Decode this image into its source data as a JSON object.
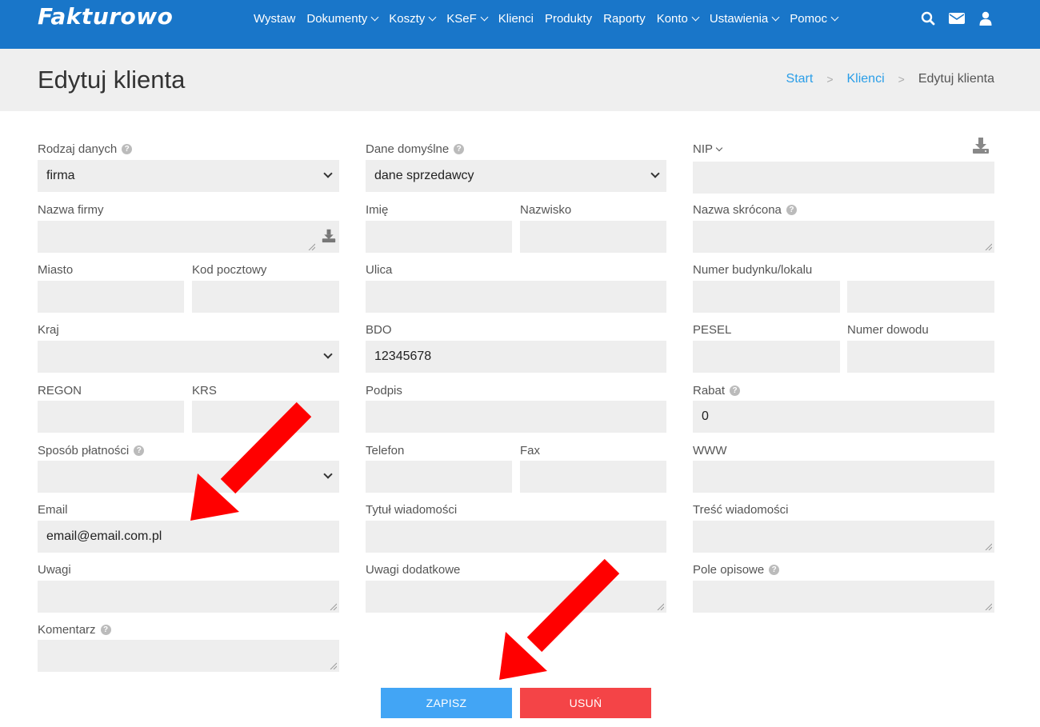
{
  "brand": {
    "logo_text": "Fakturowo"
  },
  "nav": {
    "items": [
      {
        "label": "Wystaw",
        "dropdown": false
      },
      {
        "label": "Dokumenty",
        "dropdown": true
      },
      {
        "label": "Koszty",
        "dropdown": true
      },
      {
        "label": "KSeF",
        "dropdown": true
      },
      {
        "label": "Klienci",
        "dropdown": false
      },
      {
        "label": "Produkty",
        "dropdown": false
      },
      {
        "label": "Raporty",
        "dropdown": false
      },
      {
        "label": "Konto",
        "dropdown": true
      },
      {
        "label": "Ustawienia",
        "dropdown": true
      },
      {
        "label": "Pomoc",
        "dropdown": true
      }
    ],
    "icons": [
      "search-icon",
      "envelope-icon",
      "user-icon"
    ]
  },
  "header": {
    "title": "Edytuj klienta",
    "breadcrumb": {
      "start": "Start",
      "klienci": "Klienci",
      "current": "Edytuj klienta",
      "separator": ">"
    }
  },
  "form": {
    "rodzaj_danych": {
      "label": "Rodzaj danych",
      "value": "firma"
    },
    "dane_domyslne": {
      "label": "Dane domyślne",
      "value": "dane sprzedawcy"
    },
    "nip": {
      "label": "NIP",
      "value": ""
    },
    "nazwa_firmy": {
      "label": "Nazwa firmy",
      "value": ""
    },
    "imie": {
      "label": "Imię",
      "value": ""
    },
    "nazwisko": {
      "label": "Nazwisko",
      "value": ""
    },
    "nazwa_skrocona": {
      "label": "Nazwa skrócona",
      "value": ""
    },
    "miasto": {
      "label": "Miasto",
      "value": ""
    },
    "kod_pocztowy": {
      "label": "Kod pocztowy",
      "value": ""
    },
    "ulica": {
      "label": "Ulica",
      "value": ""
    },
    "numer_budynku": {
      "label": "Numer budynku/lokalu",
      "value": "",
      "value2": ""
    },
    "kraj": {
      "label": "Kraj",
      "value": ""
    },
    "bdo": {
      "label": "BDO",
      "value": "12345678"
    },
    "pesel": {
      "label": "PESEL",
      "value": ""
    },
    "numer_dowodu": {
      "label": "Numer dowodu",
      "value": ""
    },
    "regon": {
      "label": "REGON",
      "value": ""
    },
    "krs": {
      "label": "KRS",
      "value": ""
    },
    "podpis": {
      "label": "Podpis",
      "value": ""
    },
    "rabat": {
      "label": "Rabat",
      "value": "0"
    },
    "sposob_platnosci": {
      "label": "Sposób płatności",
      "value": ""
    },
    "telefon": {
      "label": "Telefon",
      "value": ""
    },
    "fax": {
      "label": "Fax",
      "value": ""
    },
    "www": {
      "label": "WWW",
      "value": ""
    },
    "email": {
      "label": "Email",
      "value": "email@email.com.pl"
    },
    "tytul_wiadomosci": {
      "label": "Tytuł wiadomości",
      "value": ""
    },
    "tresc_wiadomosci": {
      "label": "Treść wiadomości",
      "value": ""
    },
    "uwagi": {
      "label": "Uwagi",
      "value": ""
    },
    "uwagi_dodatkowe": {
      "label": "Uwagi dodatkowe",
      "value": ""
    },
    "pole_opisowe": {
      "label": "Pole opisowe",
      "value": ""
    },
    "komentarz": {
      "label": "Komentarz",
      "value": ""
    }
  },
  "buttons": {
    "save": "ZAPISZ",
    "delete": "USUŃ"
  },
  "colors": {
    "navbar": "#1976c9",
    "save": "#42a5f5",
    "delete": "#f44447",
    "annotation_arrow": "#ff0000"
  }
}
